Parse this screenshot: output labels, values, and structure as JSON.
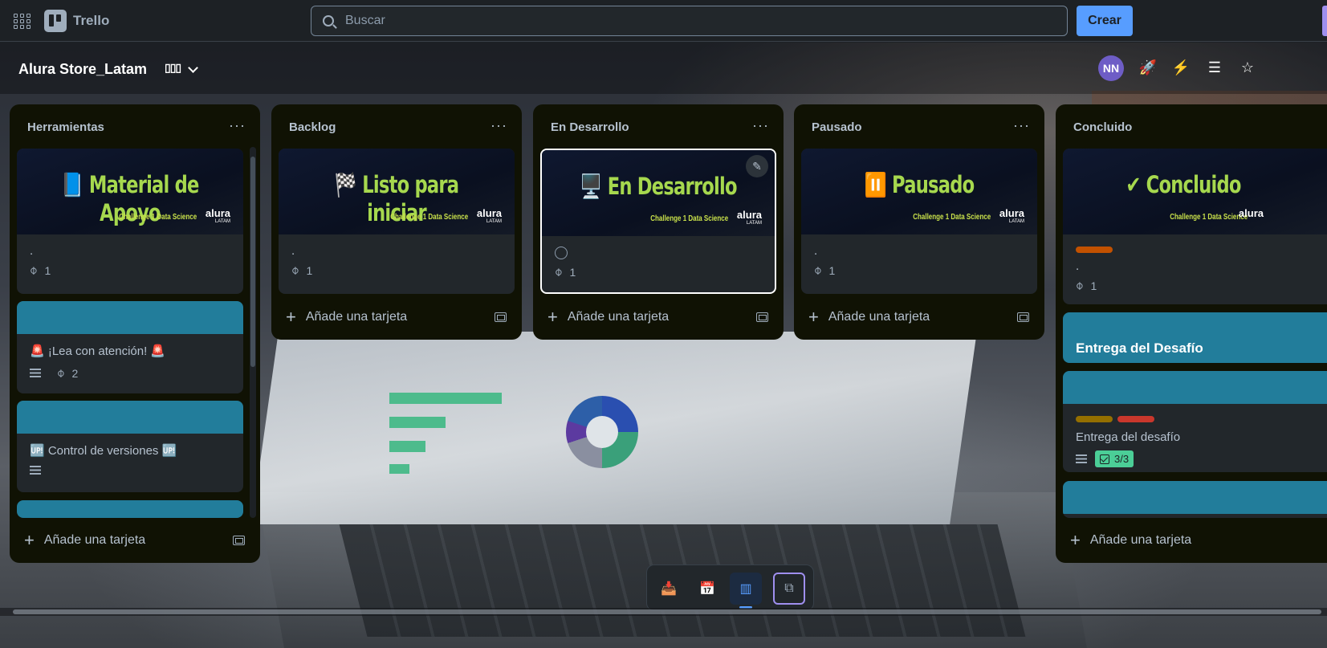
{
  "app": {
    "name": "Trello"
  },
  "search": {
    "placeholder": "Buscar"
  },
  "create_label": "Crear",
  "board": {
    "title": "Alura Store_Latam",
    "view_icon_glyph": "▯▯▯"
  },
  "member": {
    "initials": "NN"
  },
  "lists": [
    {
      "title": "Herramientas",
      "cover_title": "📘 Material de Apoyo",
      "cover_sub": "Challenge 1 Data Science",
      "brand": "alura",
      "brand_sub": "LATAM",
      "first_card_text": ".",
      "first_card_attachments": "1",
      "card2_title": "🚨 ¡Lea con atención! 🚨",
      "card2_attachments": "2",
      "card3_title": "🆙 Control de versiones 🆙",
      "add_label": "Añade una tarjeta"
    },
    {
      "title": "Backlog",
      "cover_title": "🏁 Listo para iniciar",
      "cover_sub": "Challenge 1 Data Science",
      "brand": "alura",
      "brand_sub": "LATAM",
      "first_card_text": ".",
      "first_card_attachments": "1",
      "add_label": "Añade una tarjeta"
    },
    {
      "title": "En Desarrollo",
      "cover_title": "🖥️ En Desarrollo",
      "cover_sub": "Challenge 1 Data Science",
      "brand": "alura",
      "brand_sub": "LATAM",
      "first_card_text": ".",
      "first_card_attachments": "1",
      "add_label": "Añade una tarjeta"
    },
    {
      "title": "Pausado",
      "cover_title": "⏸️ Pausado",
      "cover_sub": "Challenge 1 Data Science",
      "brand": "alura",
      "brand_sub": "LATAM",
      "first_card_text": ".",
      "first_card_attachments": "1",
      "add_label": "Añade una tarjeta"
    },
    {
      "title": "Concluido",
      "cover_title": "✔ Concluido",
      "cover_sub": "Challenge 1 Data Science",
      "brand": "alura",
      "first_card_text": ".",
      "first_card_attachments": "1",
      "card2_title": "Entrega del Desafío",
      "card3_title": "Entrega del desafío",
      "card3_checklist": "3/3",
      "add_label": "Añade una tarjeta"
    }
  ],
  "colors": {
    "accent": "#579dff",
    "list_bg": "#101204",
    "card_bg": "#22272b",
    "teal_cover": "#227d9b",
    "label_orange": "#c25100",
    "label_yellow": "#946f00",
    "label_red": "#c9372c",
    "cover_title_green": "#a6d84e"
  },
  "icons": {
    "apps": "apps-grid-icon",
    "search": "search-icon",
    "power_up": "rocket-icon",
    "automation": "lightning-icon",
    "filter": "filter-icon",
    "star": "star-icon",
    "attachment": "paperclip-icon",
    "description": "description-icon",
    "checklist": "checklist-icon",
    "template": "card-template-icon",
    "edit": "edit-icon",
    "inbox": "inbox-icon",
    "planner": "calendar-icon",
    "board": "board-icon",
    "switch_boards": "switch-boards-icon"
  }
}
